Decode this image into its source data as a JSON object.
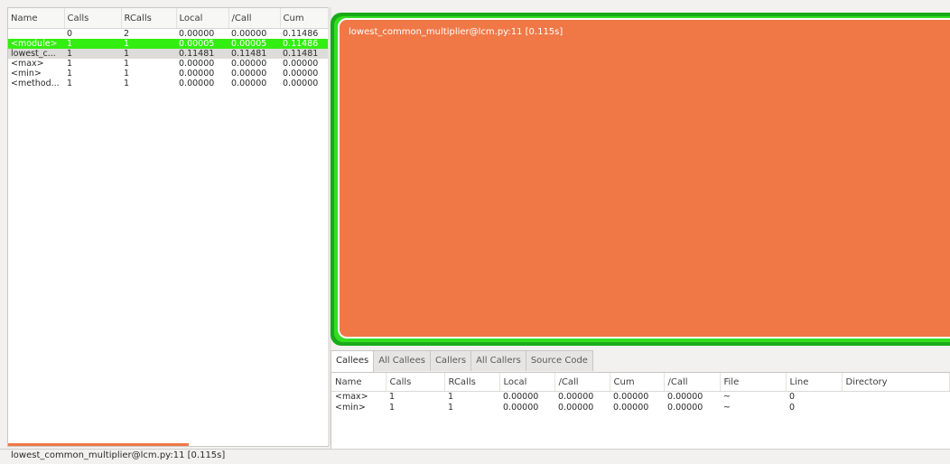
{
  "function_table": {
    "columns": [
      "Name",
      "Calls",
      "RCalls",
      "Local",
      "/Call",
      "Cum"
    ],
    "rows": [
      [
        "",
        "0",
        "2",
        "0.00000",
        "0.00000",
        "0.11486"
      ],
      [
        "<module>",
        "1",
        "1",
        "0.00005",
        "0.00005",
        "0.11486"
      ],
      [
        "lowest_c...",
        "1",
        "1",
        "0.11481",
        "0.11481",
        "0.11481"
      ],
      [
        "<max>",
        "1",
        "1",
        "0.00000",
        "0.00000",
        "0.00000"
      ],
      [
        "<min>",
        "1",
        "1",
        "0.00000",
        "0.00000",
        "0.00000"
      ],
      [
        "<method...",
        "1",
        "1",
        "0.00000",
        "0.00000",
        "0.00000"
      ]
    ]
  },
  "flame": {
    "node_label": "lowest_common_multiplier@lcm.py:11 [0.115s]"
  },
  "tabs": [
    "Callees",
    "All Callees",
    "Callers",
    "All Callers",
    "Source Code"
  ],
  "callees_table": {
    "columns": [
      "Name",
      "Calls",
      "RCalls",
      "Local",
      "/Call",
      "Cum",
      "/Call",
      "File",
      "Line",
      "Directory"
    ],
    "rows": [
      [
        "<max>",
        "1",
        "1",
        "0.00000",
        "0.00000",
        "0.00000",
        "0.00000",
        "~",
        "0",
        ""
      ],
      [
        "<min>",
        "1",
        "1",
        "0.00000",
        "0.00000",
        "0.00000",
        "0.00000",
        "~",
        "0",
        ""
      ]
    ]
  },
  "status": {
    "text": "lowest_common_multiplier@lcm.py:11 [0.115s]"
  },
  "colors": {
    "flame_node": "#f07846",
    "selected_row": "#33ee11",
    "flame_border": "#19aa19"
  }
}
